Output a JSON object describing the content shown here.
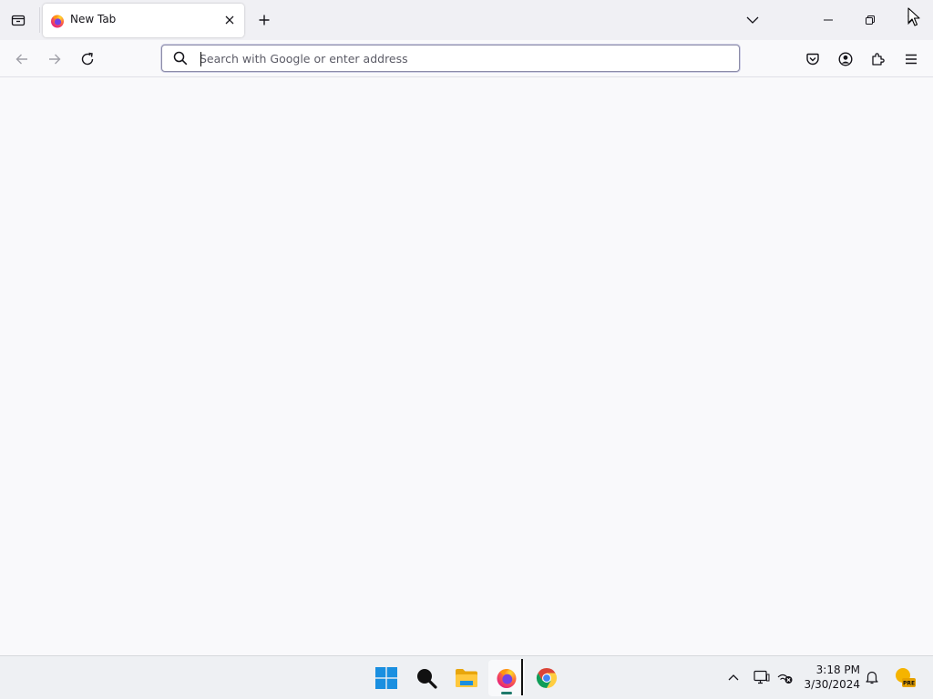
{
  "browser": {
    "tab": {
      "title": "New Tab"
    },
    "urlbar": {
      "placeholder": "Search with Google or enter address",
      "value": ""
    }
  },
  "icons": {
    "tab_list": "tab-list-icon",
    "favicon": "firefox-icon",
    "tab_close": "close-icon",
    "new_tab": "plus-icon",
    "list_all_tabs": "chevron-down-icon",
    "minimize": "minimize-icon",
    "maximize": "restore-icon",
    "close_window": "close-icon",
    "back": "arrow-left-icon",
    "forward": "arrow-right-icon",
    "reload": "reload-icon",
    "search": "search-icon",
    "pocket": "pocket-icon",
    "account": "account-icon",
    "extensions": "puzzle-icon",
    "menu": "hamburger-icon"
  },
  "taskbar": {
    "apps": [
      "Start",
      "Search",
      "File Explorer",
      "Firefox",
      "Google Chrome"
    ],
    "clock": {
      "time": "3:18 PM",
      "date": "3/30/2024"
    },
    "weather_badge": "PRE"
  },
  "colors": {
    "tab_strip": "#f0f0f4",
    "toolbar": "#f9f9fb",
    "urlbar_border": "#8c8ca8",
    "taskbar": "#eef0f3",
    "active_app_indicator": "#1e7a6c"
  }
}
